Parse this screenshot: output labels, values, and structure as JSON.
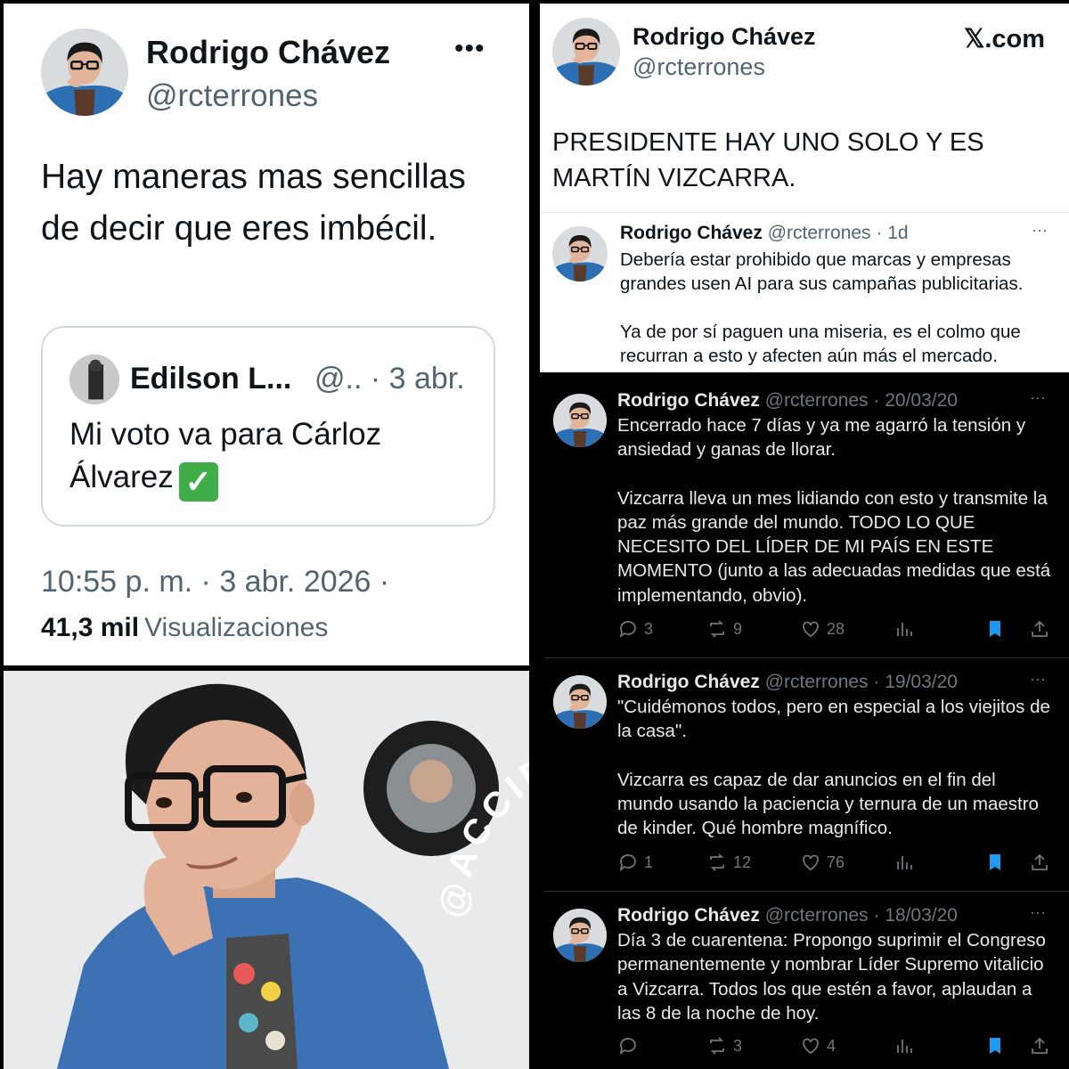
{
  "main_tweet": {
    "name": "Rodrigo Chávez",
    "handle": "@rcterrones",
    "more_icon": "•••",
    "text": "Hay maneras mas sencillas de decir que eres imbécil.",
    "quote": {
      "name": "Edilson L...",
      "meta": "@.. · 3 abr.",
      "text": "Mi voto va para Cárloz Álvarez",
      "emoji": "✓"
    },
    "timestamp": "10:55 p. m. · 3 abr. 2026 ·",
    "views_count": "41,3 mil",
    "views_label": "Visualizaciones"
  },
  "x_post": {
    "name": "Rodrigo Chávez",
    "handle": "@rcterrones",
    "brand": "𝕏.com",
    "text": "PRESIDENTE HAY UNO SOLO Y ES MARTÍN VIZCARRA.",
    "reply": {
      "name": "Rodrigo Chávez",
      "meta": "@rcterrones · 1d",
      "more_icon": "···",
      "para1": "Debería estar prohibido que marcas y empresas grandes usen AI para sus campañas publicitarias.",
      "para2": "Ya de por sí paguen una miseria, es el colmo que recurran a esto y afecten aún más el mercado."
    }
  },
  "photo": {
    "watermark": "@ACCIDENTALFUJI"
  },
  "dark_tweets": [
    {
      "name": "Rodrigo Chávez",
      "meta": "@rcterrones · 20/03/20",
      "more_icon": "···",
      "para1": "Encerrado hace 7 días y ya me agarró la tensión y ansiedad y ganas de llorar.",
      "para2": "Vizcarra lleva un mes lidiando con esto y transmite la paz más grande del mundo. TODO LO QUE NECESITO DEL LÍDER DE MI PAÍS EN ESTE MOMENTO (junto a las adecuadas medidas que está implementando, obvio).",
      "replies": "3",
      "retweets": "9",
      "likes": "28"
    },
    {
      "name": "Rodrigo Chávez",
      "meta": "@rcterrones · 19/03/20",
      "more_icon": "···",
      "para1": "\"Cuidémonos todos, pero en especial a los viejitos de la casa\".",
      "para2": "Vizcarra es capaz de dar anuncios en el fin del mundo usando la paciencia y ternura de un maestro de kinder. Qué hombre magnífico.",
      "replies": "1",
      "retweets": "12",
      "likes": "76"
    },
    {
      "name": "Rodrigo Chávez",
      "meta": "@rcterrones · 18/03/20",
      "more_icon": "···",
      "para1": "Día 3 de cuarentena: Propongo suprimir el Congreso permanentemente y nombrar Líder Supremo vitalicio a Vizcarra. Todos los que estén a favor, aplaudan a las 8 de la noche de hoy.",
      "para2": "",
      "replies": "",
      "retweets": "3",
      "likes": "4"
    }
  ],
  "colors": {
    "like_accent": "#1d9bf0",
    "bookmark": "#1d9bf0",
    "check_green": "#3fae49"
  },
  "icons": [
    "reply-icon",
    "retweet-icon",
    "like-icon",
    "views-icon",
    "bookmark-icon",
    "share-icon",
    "more-icon",
    "x-logo"
  ]
}
